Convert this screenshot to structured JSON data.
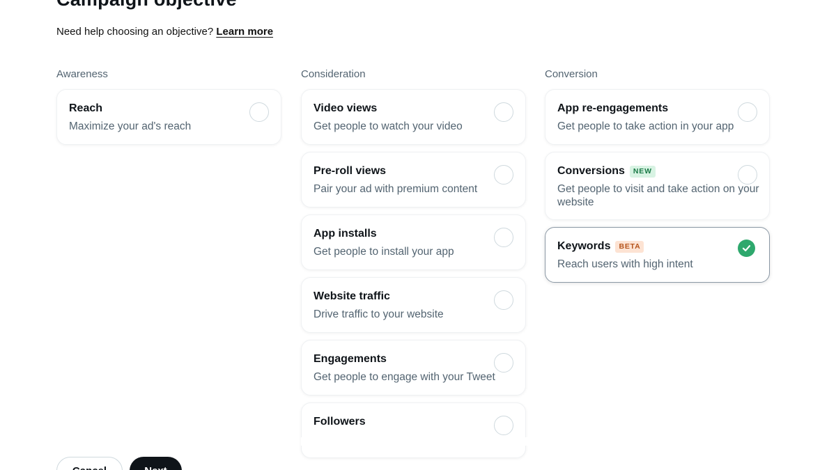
{
  "header": {
    "title": "Campaign objective",
    "help_text": "Need help choosing an objective?",
    "help_link": "Learn more"
  },
  "columns": [
    {
      "heading": "Awareness",
      "items": [
        {
          "title": "Reach",
          "desc": "Maximize your ad's reach",
          "selected": false
        }
      ]
    },
    {
      "heading": "Consideration",
      "items": [
        {
          "title": "Video views",
          "desc": "Get people to watch your video",
          "selected": false
        },
        {
          "title": "Pre-roll views",
          "desc": "Pair your ad with premium content",
          "selected": false
        },
        {
          "title": "App installs",
          "desc": "Get people to install your app",
          "selected": false
        },
        {
          "title": "Website traffic",
          "desc": "Drive traffic to your website",
          "selected": false
        },
        {
          "title": "Engagements",
          "desc": "Get people to engage with your Tweet",
          "selected": false
        },
        {
          "title": "Followers",
          "desc": "",
          "selected": false
        }
      ]
    },
    {
      "heading": "Conversion",
      "items": [
        {
          "title": "App re-engagements",
          "desc": "Get people to take action in your app",
          "selected": false
        },
        {
          "title": "Conversions",
          "badge": "NEW",
          "desc": "Get people to visit and take action on your website",
          "selected": false
        },
        {
          "title": "Keywords",
          "badge": "BETA",
          "desc": "Reach users with high intent",
          "selected": true
        }
      ]
    }
  ],
  "footer": {
    "cancel_label": "Cancel",
    "next_label": "Next"
  },
  "colors": {
    "new_badge_bg": "#d8f3e3",
    "new_badge_fg": "#1a7a47",
    "beta_badge_bg": "#fde3d3",
    "beta_badge_fg": "#b5541c",
    "selected_check": "#2ea86d"
  }
}
